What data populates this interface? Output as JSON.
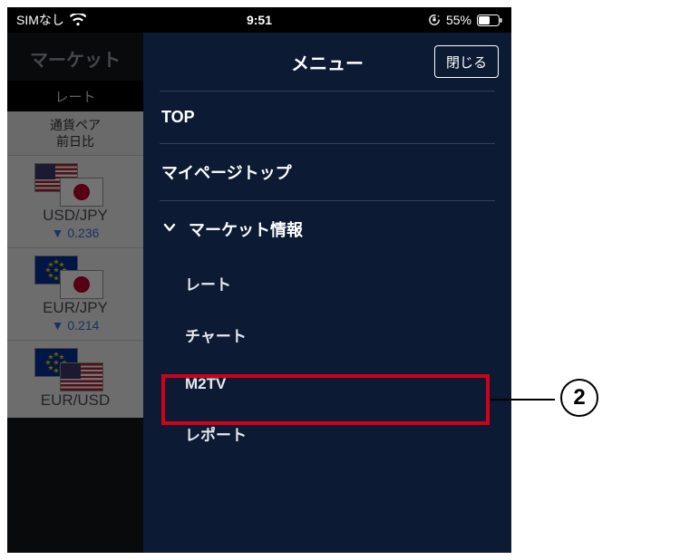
{
  "statusbar": {
    "sim": "SIMなし",
    "time": "9:51",
    "battery_pct": "55%"
  },
  "back": {
    "title": "マーケット",
    "tab": "レート",
    "col1": "通貨ペア",
    "col2": "前日比",
    "pairs": [
      {
        "name": "USD/JPY",
        "diff": "▼ 0.236",
        "flag_a": "us",
        "flag_b": "jp"
      },
      {
        "name": "EUR/JPY",
        "diff": "▼ 0.214",
        "flag_a": "eu",
        "flag_b": "jp"
      },
      {
        "name": "EUR/USD",
        "diff": "",
        "flag_a": "eu",
        "flag_b": "us"
      }
    ]
  },
  "drawer": {
    "title": "メニュー",
    "close": "閉じる",
    "items": {
      "top": "TOP",
      "mypage": "マイページトップ",
      "market": "マーケット情報",
      "subs": {
        "rate": "レート",
        "chart": "チャート",
        "m2tv": "M2TV",
        "report": "レポート"
      }
    }
  },
  "callout": {
    "num": "2"
  }
}
